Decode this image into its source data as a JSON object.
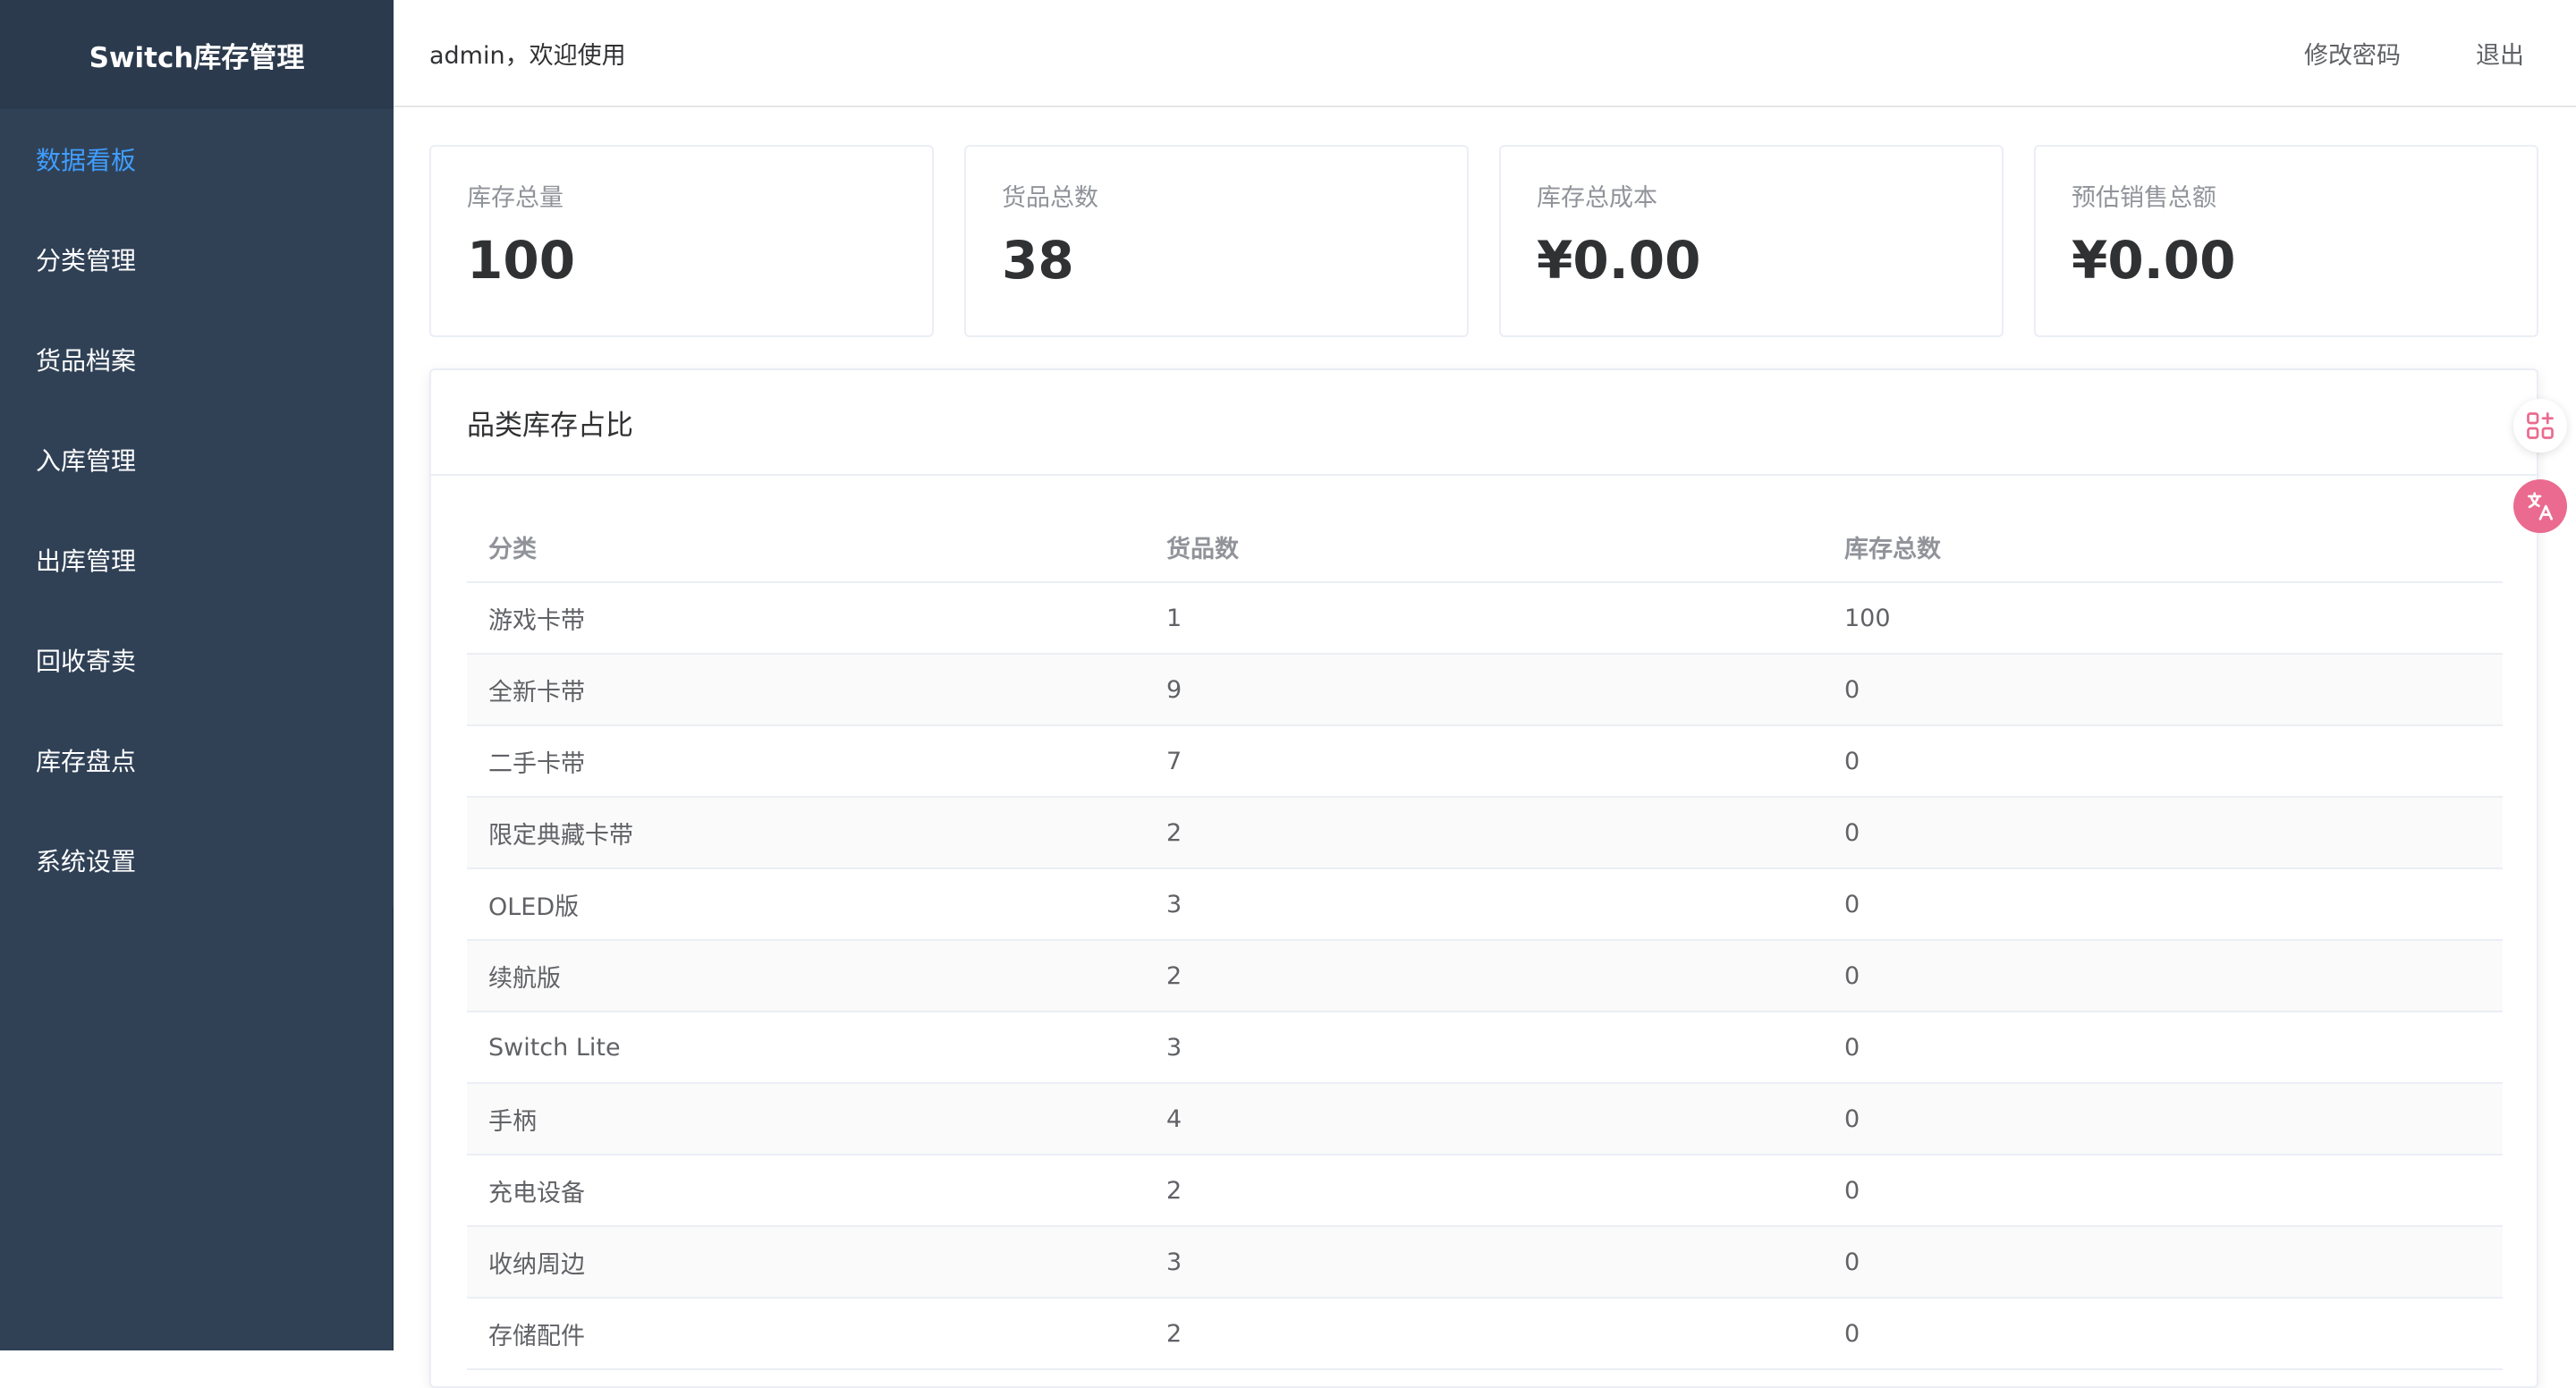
{
  "app": {
    "title": "Switch库存管理"
  },
  "sidebar": {
    "items": [
      {
        "label": "数据看板",
        "active": true
      },
      {
        "label": "分类管理",
        "active": false
      },
      {
        "label": "货品档案",
        "active": false
      },
      {
        "label": "入库管理",
        "active": false
      },
      {
        "label": "出库管理",
        "active": false
      },
      {
        "label": "回收寄卖",
        "active": false
      },
      {
        "label": "库存盘点",
        "active": false
      },
      {
        "label": "系统设置",
        "active": false
      }
    ]
  },
  "header": {
    "welcome": "admin，欢迎使用",
    "change_password": "修改密码",
    "logout": "退出"
  },
  "stats": [
    {
      "label": "库存总量",
      "value": "100"
    },
    {
      "label": "货品总数",
      "value": "38"
    },
    {
      "label": "库存总成本",
      "value": "¥0.00"
    },
    {
      "label": "预估销售总额",
      "value": "¥0.00"
    }
  ],
  "panel": {
    "title": "品类库存占比",
    "columns": [
      "分类",
      "货品数",
      "库存总数"
    ],
    "rows": [
      [
        "游戏卡带",
        "1",
        "100"
      ],
      [
        "全新卡带",
        "9",
        "0"
      ],
      [
        "二手卡带",
        "7",
        "0"
      ],
      [
        "限定典藏卡带",
        "2",
        "0"
      ],
      [
        "OLED版",
        "3",
        "0"
      ],
      [
        "续航版",
        "2",
        "0"
      ],
      [
        "Switch Lite",
        "3",
        "0"
      ],
      [
        "手柄",
        "4",
        "0"
      ],
      [
        "充电设备",
        "2",
        "0"
      ],
      [
        "收纳周边",
        "3",
        "0"
      ],
      [
        "存储配件",
        "2",
        "0"
      ]
    ]
  },
  "colors": {
    "sidebar_bg": "#304156",
    "sidebar_head_bg": "#2b3a4d",
    "active": "#409eff",
    "translate_button": "#ea6b8f"
  },
  "floating": {
    "apps_icon": "apps-plus-icon",
    "translate_icon": "translate-icon"
  }
}
